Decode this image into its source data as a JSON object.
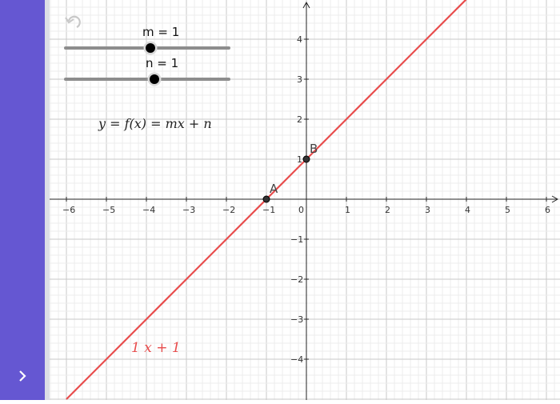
{
  "sidebar": {
    "expand_icon": "chevron-right-icon",
    "color": "#6557d2"
  },
  "toolbar": {
    "undo_icon": "undo-icon"
  },
  "sliders": [
    {
      "label": "m = 1",
      "value": 1,
      "min": -5,
      "max": 5
    },
    {
      "label": "n = 1",
      "value": 1,
      "min": -5,
      "max": 5
    }
  ],
  "formula": "y = f(x) = mx + n",
  "function_label": "1 x + 1",
  "colors": {
    "line": "#e84c4c",
    "accent": "#6557d2",
    "point": "#333333"
  },
  "points": [
    {
      "name": "A",
      "x": -1,
      "y": 0
    },
    {
      "name": "B",
      "x": 0,
      "y": 1
    }
  ],
  "axes": {
    "x_ticks": [
      "−6",
      "−5",
      "−4",
      "−3",
      "−2",
      "−1",
      "0",
      "1",
      "2",
      "3",
      "4",
      "5",
      "6"
    ],
    "y_ticks": [
      "4",
      "3",
      "2",
      "1",
      "−1",
      "−2",
      "−3",
      "−4"
    ]
  },
  "chart_data": {
    "type": "line",
    "series": [
      {
        "values": [
          [
            -6,
            -5
          ],
          [
            4,
            5
          ]
        ]
      }
    ],
    "xlim": [
      -6.5,
      6.3
    ],
    "ylim": [
      -5,
      5
    ],
    "grid": true
  }
}
